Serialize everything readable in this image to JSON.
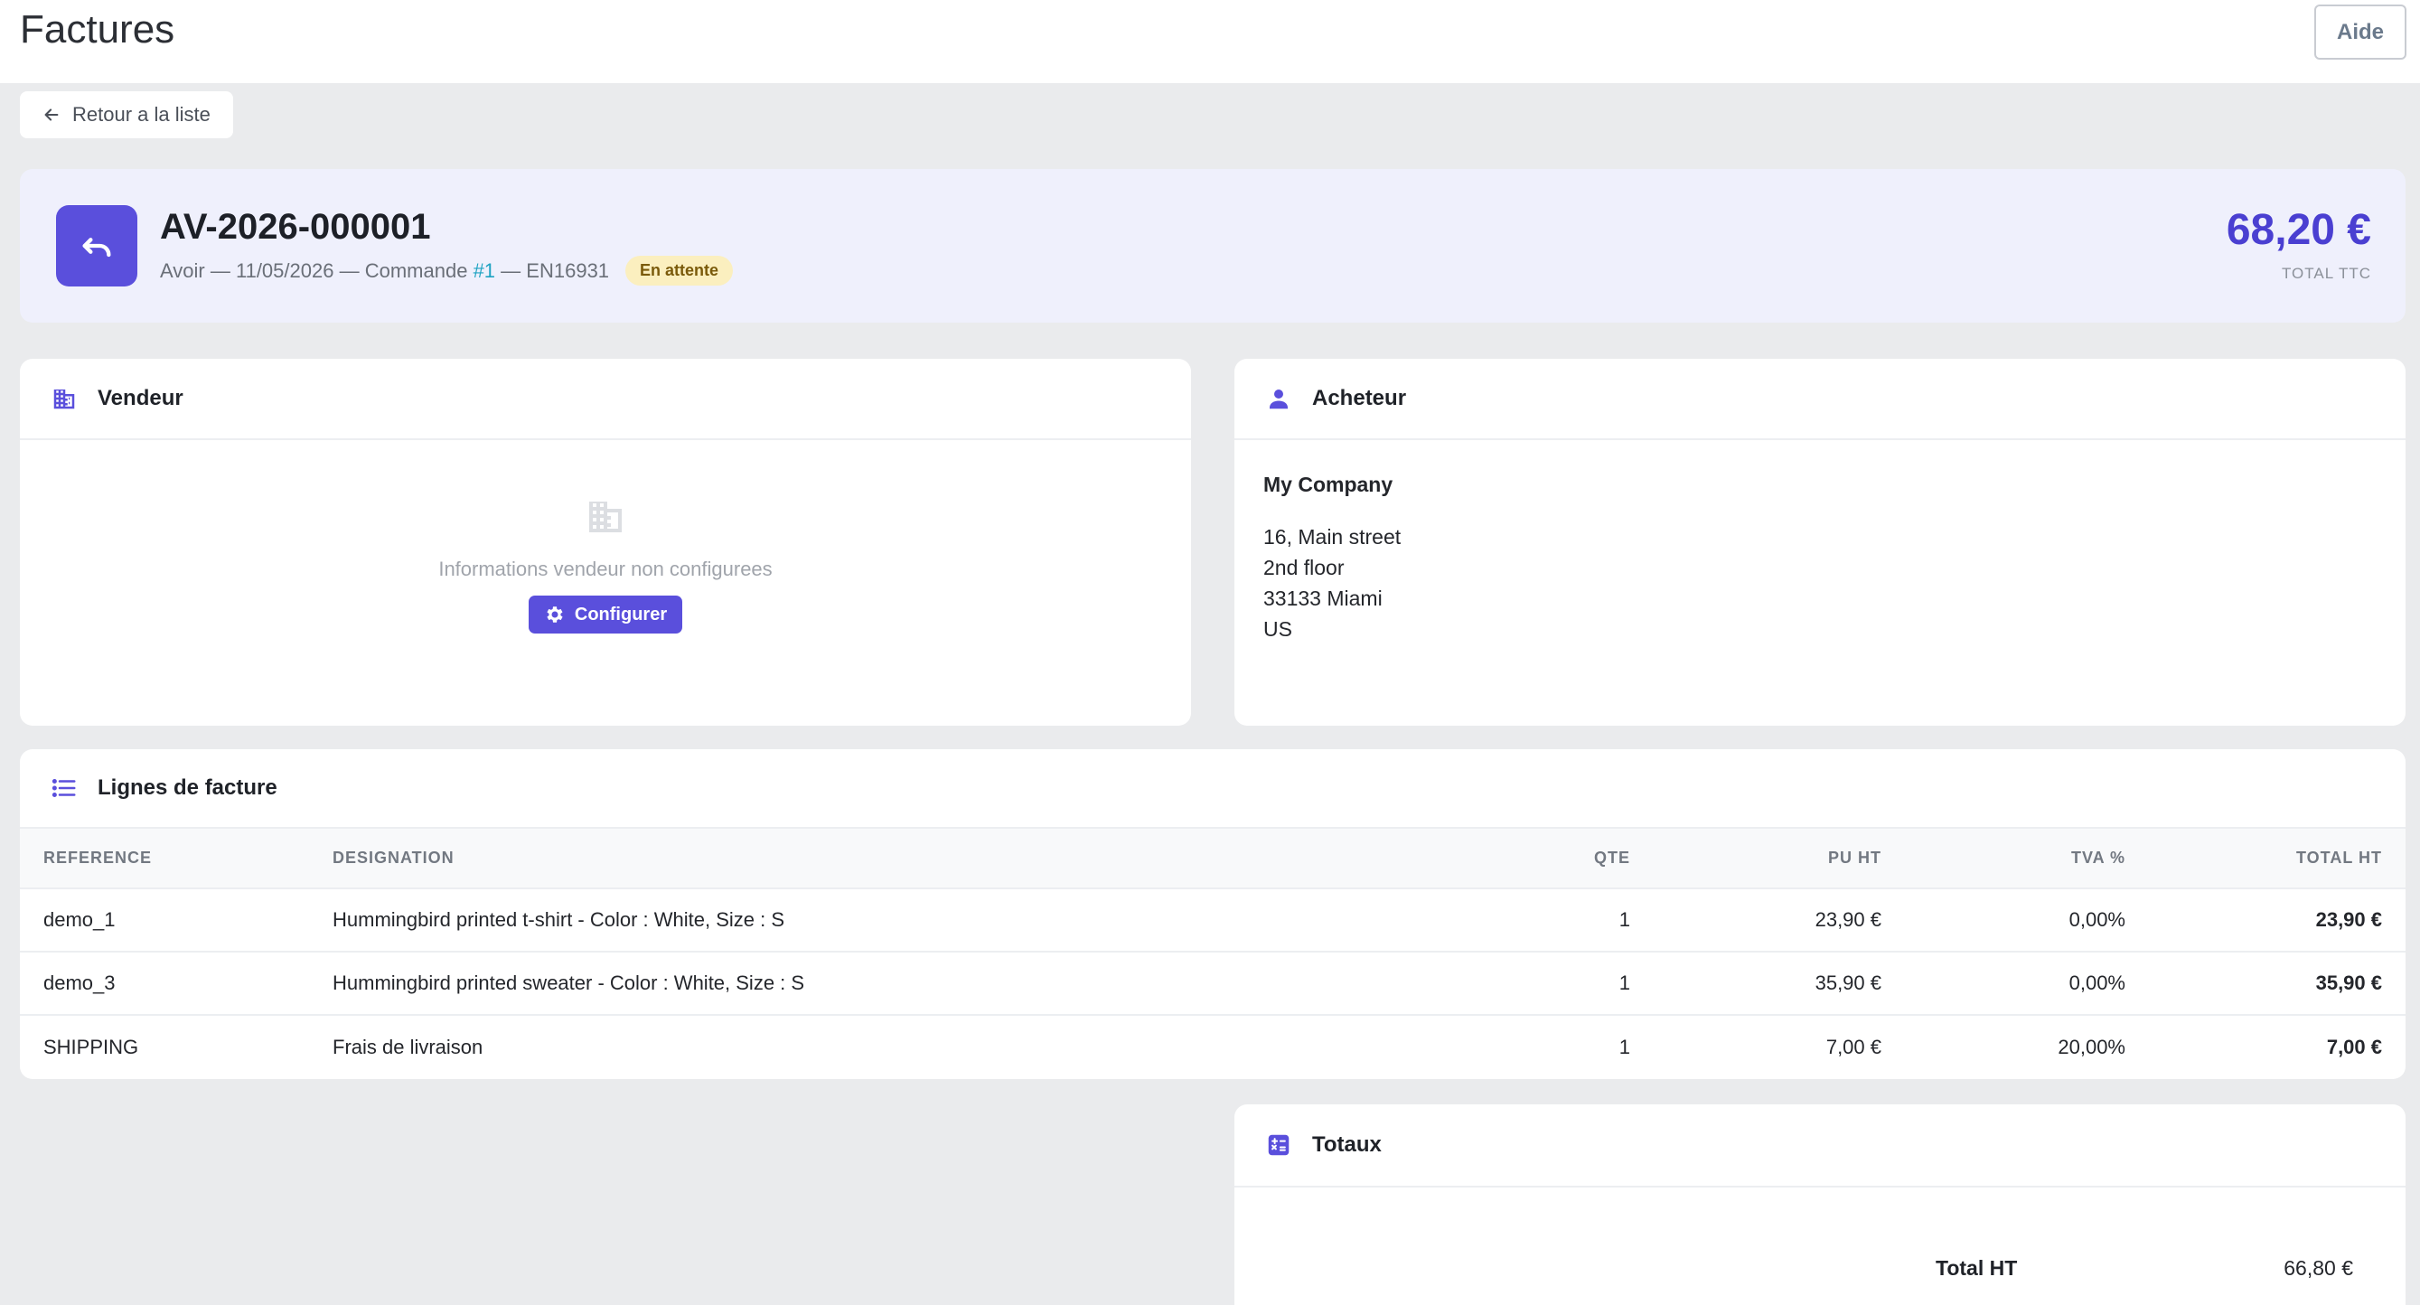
{
  "header": {
    "title": "Factures",
    "help_label": "Aide"
  },
  "back": {
    "label": "Retour a la liste"
  },
  "invoice": {
    "number": "AV-2026-000001",
    "type": "Avoir",
    "date": "11/05/2026",
    "order_label": "Commande",
    "order_link": "#1",
    "order_ref": "EN16931",
    "separator": "—",
    "status": "En attente",
    "total_amount": "68,20 €",
    "total_label": "TOTAL TTC"
  },
  "seller": {
    "title": "Vendeur",
    "empty_message": "Informations vendeur non configurees",
    "configure_label": "Configurer"
  },
  "buyer": {
    "title": "Acheteur",
    "name": "My Company",
    "address": [
      "16, Main street",
      "2nd floor",
      "33133 Miami",
      "US"
    ]
  },
  "lines": {
    "title": "Lignes de facture",
    "columns": [
      "REFERENCE",
      "DESIGNATION",
      "QTE",
      "PU HT",
      "TVA %",
      "TOTAL HT"
    ],
    "rows": [
      {
        "reference": "demo_1",
        "designation": "Hummingbird printed t-shirt - Color : White, Size : S",
        "qty": "1",
        "unit_price": "23,90 €",
        "vat": "0,00%",
        "total": "23,90 €"
      },
      {
        "reference": "demo_3",
        "designation": "Hummingbird printed sweater - Color : White, Size : S",
        "qty": "1",
        "unit_price": "35,90 €",
        "vat": "0,00%",
        "total": "35,90 €"
      },
      {
        "reference": "SHIPPING",
        "designation": "Frais de livraison",
        "qty": "1",
        "unit_price": "7,00 €",
        "vat": "20,00%",
        "total": "7,00 €"
      }
    ]
  },
  "totals": {
    "title": "Totaux",
    "total_ht_label": "Total HT",
    "total_ht_value": "66,80 €"
  },
  "icons": {
    "back": "arrow-left-icon",
    "hero": "undo-icon",
    "seller": "building-icon",
    "buyer": "person-icon",
    "lines": "list-icon",
    "totals": "calculator-icon",
    "configure": "gear-icon"
  },
  "colors": {
    "accent": "#5a4fdc",
    "amount": "#4a3fd1",
    "badge_bg": "#fbefbf",
    "link": "#1fa3c2"
  }
}
